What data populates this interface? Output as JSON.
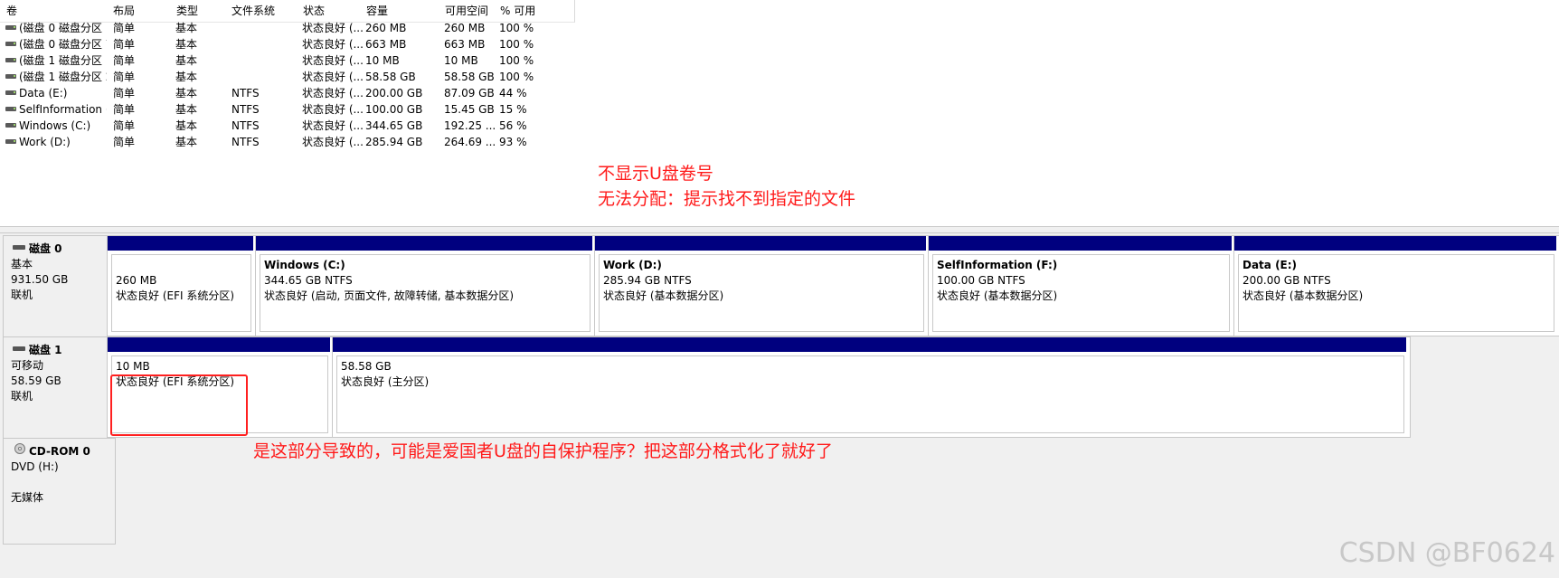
{
  "columns": [
    "卷",
    "布局",
    "类型",
    "文件系统",
    "状态",
    "容量",
    "可用空间",
    "% 可用"
  ],
  "volumes": [
    {
      "name": "(磁盘 0 磁盘分区 1)",
      "layout": "简单",
      "type": "基本",
      "fs": "",
      "status": "状态良好 (...",
      "capacity": "260 MB",
      "free": "260 MB",
      "pct": "100 %"
    },
    {
      "name": "(磁盘 0 磁盘分区 7)",
      "layout": "简单",
      "type": "基本",
      "fs": "",
      "status": "状态良好 (...",
      "capacity": "663 MB",
      "free": "663 MB",
      "pct": "100 %"
    },
    {
      "name": "(磁盘 1 磁盘分区 1)",
      "layout": "简单",
      "type": "基本",
      "fs": "",
      "status": "状态良好 (...",
      "capacity": "10 MB",
      "free": "10 MB",
      "pct": "100 %"
    },
    {
      "name": "(磁盘 1 磁盘分区 2)",
      "layout": "简单",
      "type": "基本",
      "fs": "",
      "status": "状态良好 (...",
      "capacity": "58.58 GB",
      "free": "58.58 GB",
      "pct": "100 %"
    },
    {
      "name": "Data (E:)",
      "layout": "简单",
      "type": "基本",
      "fs": "NTFS",
      "status": "状态良好 (...",
      "capacity": "200.00 GB",
      "free": "87.09 GB",
      "pct": "44 %"
    },
    {
      "name": "SelfInformation (...",
      "layout": "简单",
      "type": "基本",
      "fs": "NTFS",
      "status": "状态良好 (...",
      "capacity": "100.00 GB",
      "free": "15.45 GB",
      "pct": "15 %"
    },
    {
      "name": "Windows (C:)",
      "layout": "简单",
      "type": "基本",
      "fs": "NTFS",
      "status": "状态良好 (...",
      "capacity": "344.65 GB",
      "free": "192.25 ...",
      "pct": "56 %"
    },
    {
      "name": "Work (D:)",
      "layout": "简单",
      "type": "基本",
      "fs": "NTFS",
      "status": "状态良好 (...",
      "capacity": "285.94 GB",
      "free": "264.69 ...",
      "pct": "93 %"
    }
  ],
  "annotations": {
    "line1": "不显示U盘卷号",
    "line2": "无法分配：提示找不到指定的文件",
    "line3": "是这部分导致的，可能是爱国者U盘的自保护程序？把这部分格式化了就好了"
  },
  "disks": [
    {
      "name": "磁盘 0",
      "kind": "基本",
      "size": "931.50 GB",
      "state": "联机",
      "partitions": [
        {
          "name": "",
          "size": "260 MB",
          "status": "状态良好 (EFI 系统分区)"
        },
        {
          "name": "Windows  (C:)",
          "size": "344.65 GB NTFS",
          "status": "状态良好 (启动, 页面文件, 故障转储, 基本数据分区)"
        },
        {
          "name": "Work  (D:)",
          "size": "285.94 GB NTFS",
          "status": "状态良好 (基本数据分区)"
        },
        {
          "name": "SelfInformation  (F:)",
          "size": "100.00 GB NTFS",
          "status": "状态良好 (基本数据分区)"
        },
        {
          "name": "Data  (E:)",
          "size": "200.00 GB NTFS",
          "status": "状态良好 (基本数据分区)"
        }
      ]
    },
    {
      "name": "磁盘 1",
      "kind": "可移动",
      "size": "58.59 GB",
      "state": "联机",
      "partitions": [
        {
          "size": "10 MB",
          "status": "状态良好 (EFI 系统分区)"
        },
        {
          "size": "58.58 GB",
          "status": "状态良好 (主分区)"
        }
      ]
    }
  ],
  "cdrom": {
    "name": "CD-ROM 0",
    "drive": "DVD (H:)",
    "media": "无媒体"
  },
  "watermark": "CSDN @BF0624",
  "colors": {
    "partition_bar": "#00007f",
    "annotation": "#ff1a1a"
  }
}
